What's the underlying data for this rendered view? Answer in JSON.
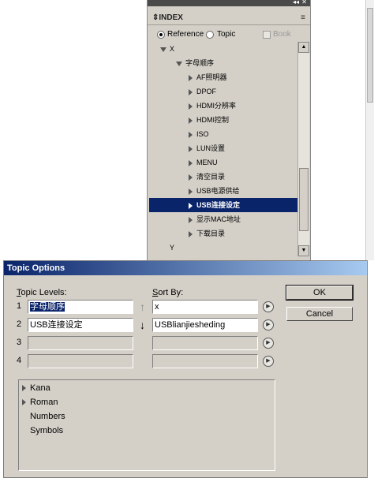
{
  "index_panel": {
    "tab_title": "INDEX",
    "collapse_glyph": "◂◂",
    "close_glyph": "✕",
    "menu_glyph": "≡",
    "options": {
      "reference_label": "Reference",
      "topic_label": "Topic",
      "book_label": "Book",
      "selected": "Reference"
    },
    "tree": [
      {
        "label": "X",
        "level": 0,
        "expanded": true
      },
      {
        "label": "字母顺序",
        "level": 1,
        "expanded": true
      },
      {
        "label": "AF照明器",
        "level": 2
      },
      {
        "label": "DPOF",
        "level": 2
      },
      {
        "label": "HDMI分辨率",
        "level": 2
      },
      {
        "label": "HDMI控制",
        "level": 2
      },
      {
        "label": "ISO",
        "level": 2
      },
      {
        "label": "LUN设置",
        "level": 2
      },
      {
        "label": "MENU",
        "level": 2
      },
      {
        "label": "清空目录",
        "level": 2
      },
      {
        "label": "USB电源供给",
        "level": 2
      },
      {
        "label": "USB连接设定",
        "level": 2,
        "selected": true
      },
      {
        "label": "显示MAC地址",
        "level": 2
      },
      {
        "label": "下载目录",
        "level": 2
      },
      {
        "label": "Y",
        "level": 0
      }
    ]
  },
  "dialog": {
    "title": "Topic Options",
    "topic_levels_label": "Topic Levels:",
    "sort_by_label": "Sort By:",
    "rows": [
      {
        "num": "1",
        "topic": "字母顺序",
        "sort": "x",
        "topic_selected": true,
        "enabled": true
      },
      {
        "num": "2",
        "topic": "USB连接设定",
        "sort": "USBlianjiesheding",
        "enabled": true
      },
      {
        "num": "3",
        "topic": "",
        "sort": "",
        "enabled": false
      },
      {
        "num": "4",
        "topic": "",
        "sort": "",
        "enabled": false
      }
    ],
    "up_arrow": "↑",
    "down_arrow": "↓",
    "ok_label": "OK",
    "cancel_label": "Cancel",
    "list_items": [
      {
        "label": "Kana",
        "expandable": true
      },
      {
        "label": "Roman",
        "expandable": true
      },
      {
        "label": "Numbers",
        "expandable": false
      },
      {
        "label": "Symbols",
        "expandable": false
      }
    ]
  },
  "colors": {
    "panel_bg": "#d4d0c8",
    "selection": "#0a246a"
  }
}
